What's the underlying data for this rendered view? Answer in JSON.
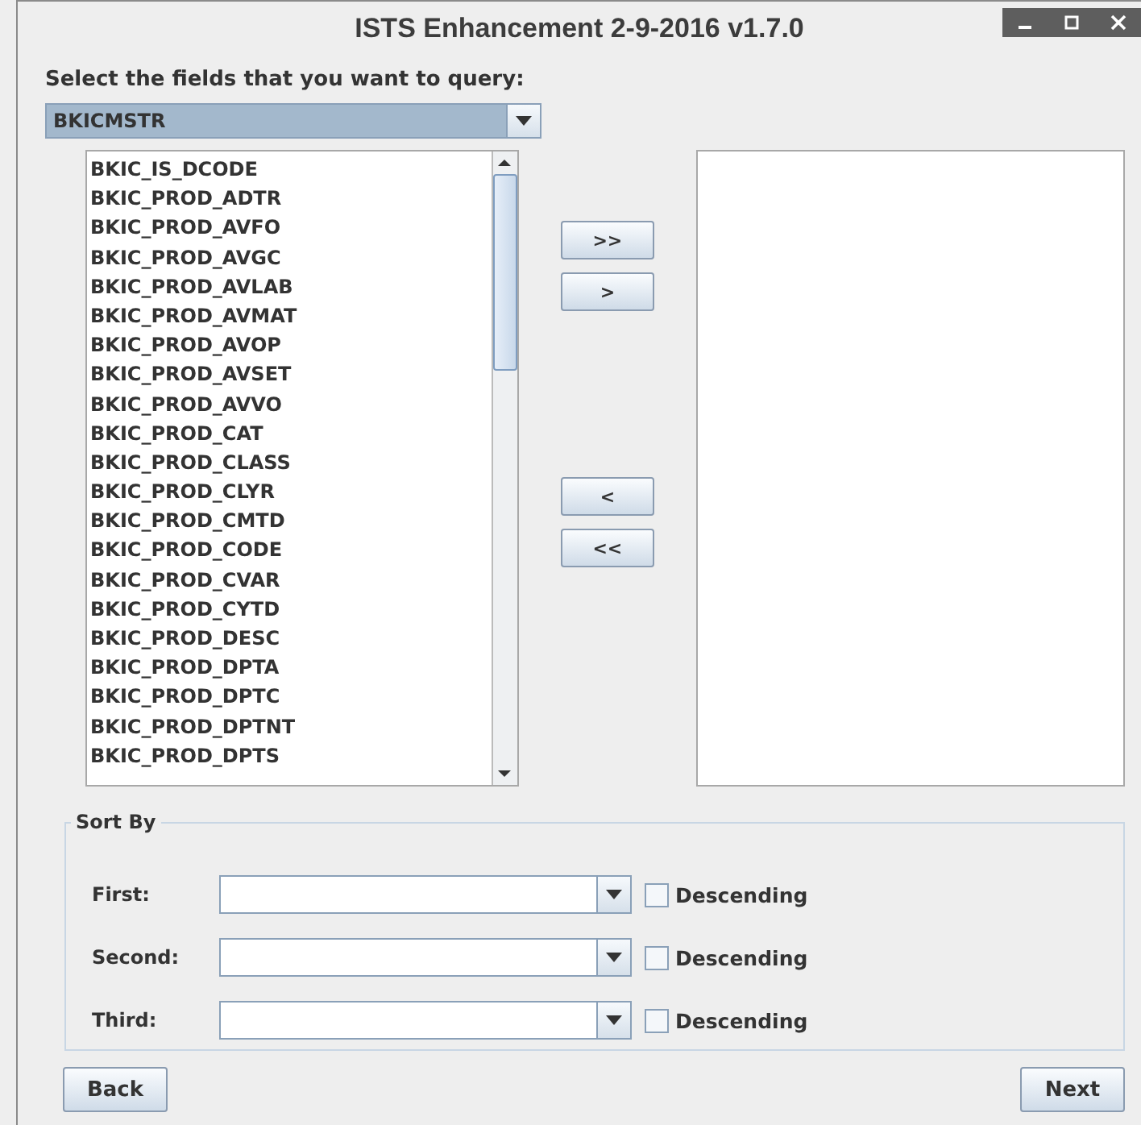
{
  "window": {
    "title": "ISTS Enhancement 2-9-2016 v1.7.0"
  },
  "prompt": "Select the fields that you want to query:",
  "table_select": {
    "value": "BKICMSTR"
  },
  "available_fields": [
    "BKIC_IS_DCODE",
    "BKIC_PROD_ADTR",
    "BKIC_PROD_AVFO",
    "BKIC_PROD_AVGC",
    "BKIC_PROD_AVLAB",
    "BKIC_PROD_AVMAT",
    "BKIC_PROD_AVOP",
    "BKIC_PROD_AVSET",
    "BKIC_PROD_AVVO",
    "BKIC_PROD_CAT",
    "BKIC_PROD_CLASS",
    "BKIC_PROD_CLYR",
    "BKIC_PROD_CMTD",
    "BKIC_PROD_CODE",
    "BKIC_PROD_CVAR",
    "BKIC_PROD_CYTD",
    "BKIC_PROD_DESC",
    "BKIC_PROD_DPTA",
    "BKIC_PROD_DPTC",
    "BKIC_PROD_DPTNT",
    "BKIC_PROD_DPTS"
  ],
  "move_buttons": {
    "add": [
      ">>",
      ">"
    ],
    "remove": [
      "<",
      "<<"
    ]
  },
  "sort_by": {
    "title": "Sort By",
    "rows": [
      {
        "label": "First:",
        "descending_label": "Descending",
        "checked": false
      },
      {
        "label": "Second:",
        "descending_label": "Descending",
        "checked": false
      },
      {
        "label": "Third:",
        "descending_label": "Descending",
        "checked": false
      }
    ]
  },
  "buttons": {
    "back": "Back",
    "next": "Next"
  }
}
